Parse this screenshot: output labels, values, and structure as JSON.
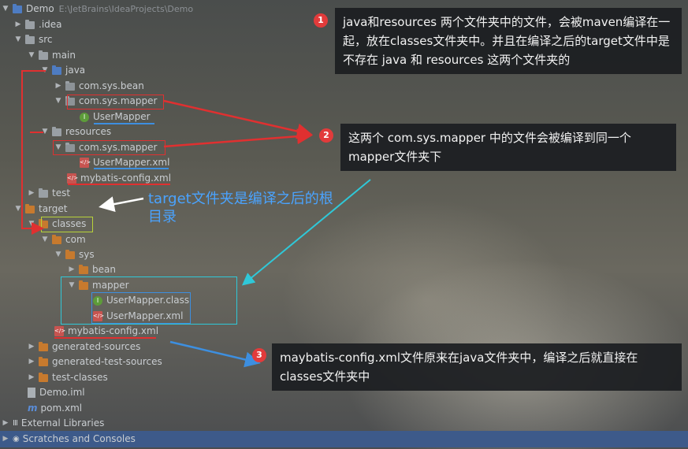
{
  "tree": {
    "root": {
      "name": "Demo",
      "path": "E:\\JetBrains\\IdeaProjects\\Demo"
    },
    "items": [
      {
        "label": ".idea"
      },
      {
        "label": "src"
      },
      {
        "label": "main"
      },
      {
        "label": "java"
      },
      {
        "label": "com.sys.bean"
      },
      {
        "label": "com.sys.mapper"
      },
      {
        "label": "UserMapper"
      },
      {
        "label": "resources"
      },
      {
        "label": "com.sys.mapper"
      },
      {
        "label": "UserMapper.xml"
      },
      {
        "label": "mybatis-config.xml"
      },
      {
        "label": "test"
      },
      {
        "label": "target"
      },
      {
        "label": "classes"
      },
      {
        "label": "com"
      },
      {
        "label": "sys"
      },
      {
        "label": "bean"
      },
      {
        "label": "mapper"
      },
      {
        "label": "UserMapper.class"
      },
      {
        "label": "UserMapper.xml"
      },
      {
        "label": "mybatis-config.xml"
      },
      {
        "label": "generated-sources"
      },
      {
        "label": "generated-test-sources"
      },
      {
        "label": "test-classes"
      },
      {
        "label": "Demo.iml"
      },
      {
        "label": "pom.xml"
      },
      {
        "label": "External Libraries"
      },
      {
        "label": "Scratches and Consoles"
      }
    ]
  },
  "annotations": {
    "callout1": {
      "num": "1",
      "text": "java和resources 两个文件夹中的文件，会被maven编译在一起，放在classes文件夹中。并且在编译之后的target文件中是不存在 java 和 resources 这两个文件夹的"
    },
    "callout2": {
      "num": "2",
      "text": "这两个 com.sys.mapper 中的文件会被编译到同一个mapper文件夹下"
    },
    "callout3": {
      "num": "3",
      "text": "maybatis-config.xml文件原来在java文件夹中，编译之后就直接在classes文件夹中"
    },
    "target_note": "target文件夹是编译之后的根目录"
  },
  "colors": {
    "red": "#e03030",
    "blue": "#3d8fe0",
    "cyan": "#2fc8d8",
    "yellow": "#b8d23a",
    "white": "#ffffff"
  }
}
